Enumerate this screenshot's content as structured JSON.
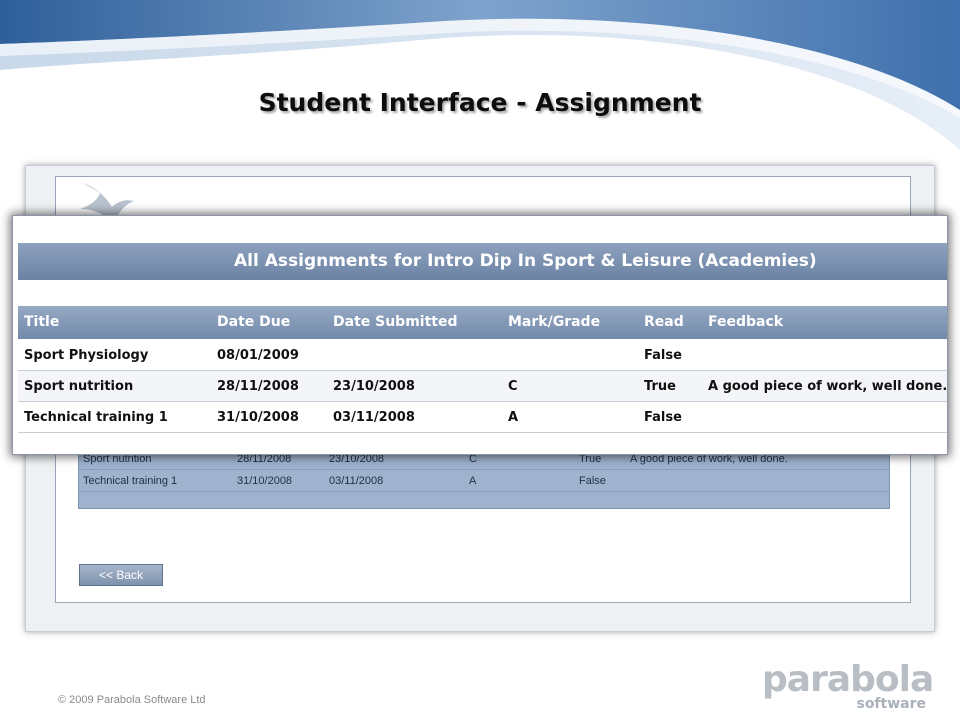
{
  "slide": {
    "title": "Student Interface - Assignment",
    "copyright": "© 2009 Parabola Software Ltd",
    "brand_main": "parabola",
    "brand_sub": "software"
  },
  "zoom_panel": {
    "heading": "All Assignments for Intro Dip In Sport & Leisure (Academies)",
    "columns": [
      "Title",
      "Date Due",
      "Date Submitted",
      "Mark/Grade",
      "Read",
      "Feedback"
    ],
    "rows": [
      [
        "Sport Physiology",
        "08/01/2009",
        "",
        "",
        "False",
        ""
      ],
      [
        "Sport nutrition",
        "28/11/2008",
        "23/10/2008",
        "C",
        "True",
        "A good piece of work, well done."
      ],
      [
        "Technical training 1",
        "31/10/2008",
        "03/11/2008",
        "A",
        "False",
        ""
      ]
    ]
  },
  "background_table": {
    "rows": [
      [
        "Sport nutrition",
        "28/11/2008",
        "23/10/2008",
        "C",
        "True",
        "A good piece of work, well done."
      ],
      [
        "Technical training 1",
        "31/10/2008",
        "03/11/2008",
        "A",
        "False",
        ""
      ]
    ]
  },
  "back_button": {
    "label": "<< Back"
  },
  "colors": {
    "header_blue": "#6b82a3",
    "swoosh_blue": "#3d6ea8",
    "row_border": "#c7cdd5"
  }
}
